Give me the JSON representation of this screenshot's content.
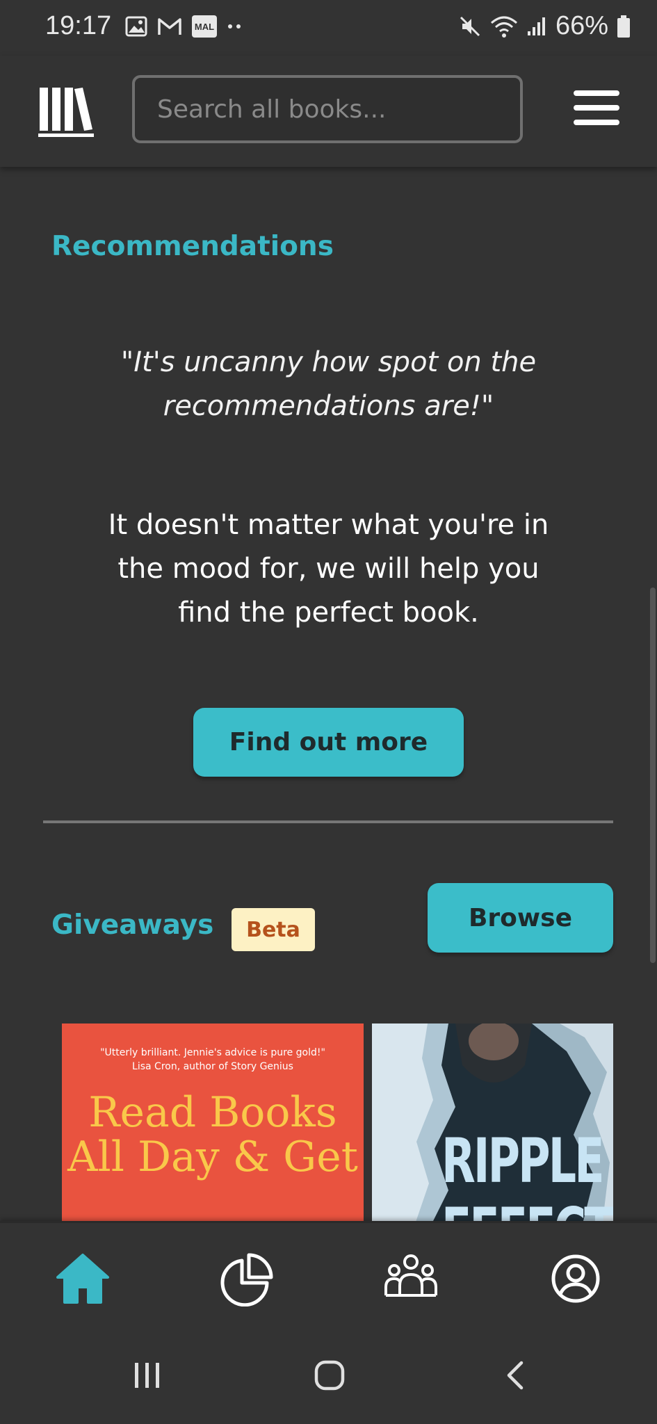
{
  "status_bar": {
    "time": "19:17",
    "battery": "66%",
    "icons": [
      "gallery-icon",
      "gmail-icon",
      "mal-icon",
      "dots-icon",
      "mute-icon",
      "wifi-icon",
      "signal-icon",
      "battery-icon"
    ],
    "mal_label": "MAL"
  },
  "header": {
    "logo_icon": "books-logo-icon",
    "search_placeholder": "Search all books...",
    "menu_icon": "hamburger-menu-icon"
  },
  "recommendations": {
    "title": "Recommendations",
    "quote": "\"It's uncanny how spot on the recommendations are!\"",
    "description": "It doesn't matter what you're in the mood for, we will help you find the perfect book.",
    "button_label": "Find out more"
  },
  "giveaways": {
    "title": "Giveaways",
    "badge": "Beta",
    "browse_label": "Browse",
    "books": [
      {
        "blurb_line1": "\"Utterly brilliant. Jennie's advice is pure gold!\"",
        "blurb_line2": "Lisa Cron, author of Story Genius",
        "title": "Read Books All Day & Get",
        "bg": "#e9533f",
        "title_color": "#f9c84a"
      },
      {
        "title": "RIPPLE EFFECT",
        "bg": "#1b2a33",
        "title_color": "#c8e4f4"
      }
    ]
  },
  "bottom_nav": {
    "items": [
      "home-icon",
      "stats-pie-icon",
      "community-icon",
      "profile-icon"
    ],
    "active": "home-icon",
    "active_color": "#3bb8c6"
  },
  "system_nav": [
    "recents-icon",
    "home-circle-icon",
    "back-icon"
  ],
  "colors": {
    "accent": "#3bbdc9",
    "background": "#333333",
    "badge_bg": "#fdf1c4",
    "badge_text": "#b5521c"
  }
}
